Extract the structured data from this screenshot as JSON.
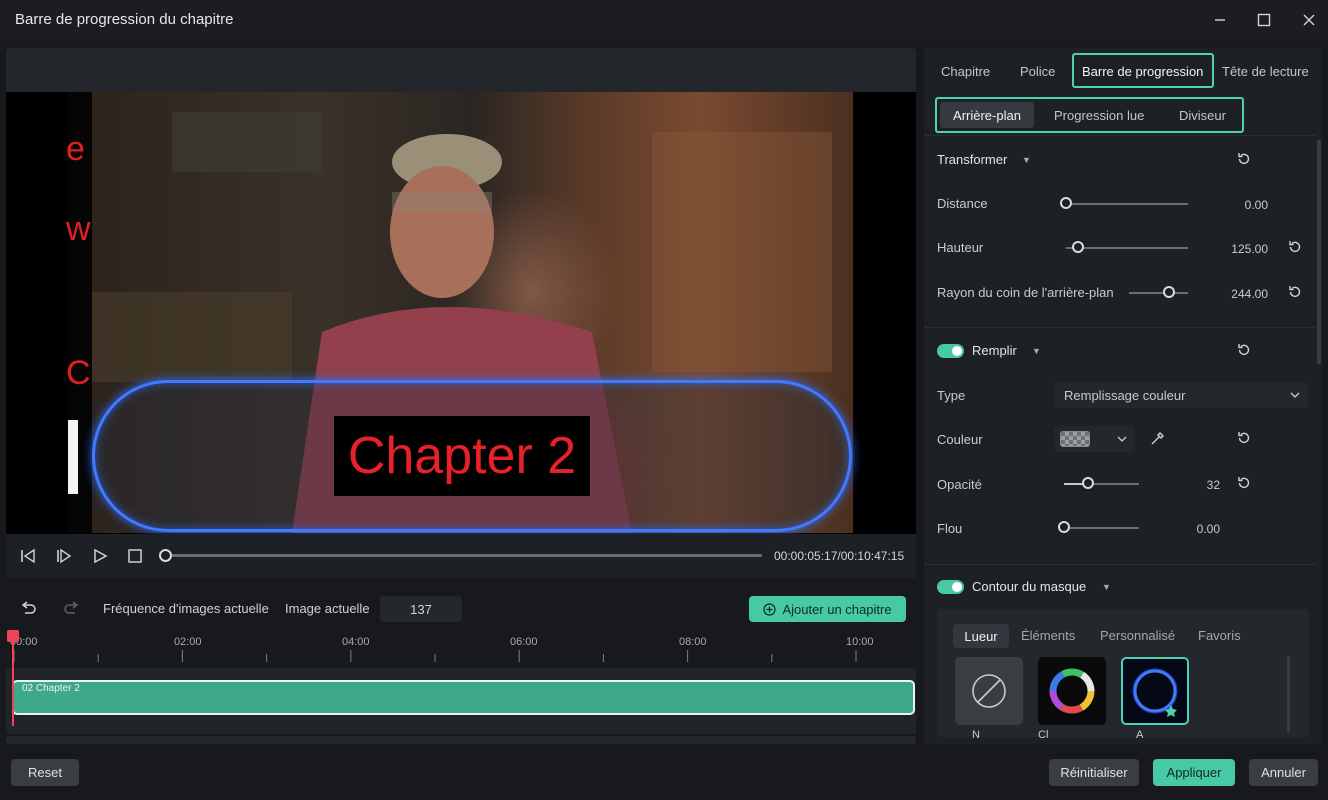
{
  "window": {
    "title": "Barre de progression du chapitre"
  },
  "preview": {
    "side_letters": [
      "e",
      "w",
      "C"
    ],
    "chapter_text": "Chapter 2",
    "timecode": "00:00:05:17/00:10:47:15"
  },
  "timeline": {
    "fps_label": "Fréquence d'images actuelle",
    "image_label": "Image actuelle",
    "image_value": "137",
    "add_chapter_label": "Ajouter un chapitre",
    "ticks": [
      "00:00",
      "02:00",
      "04:00",
      "06:00",
      "08:00",
      "10:00"
    ],
    "clip_label": "02 Chapter 2",
    "scrub_progress": 0
  },
  "panel": {
    "tabs": [
      "Chapitre",
      "Police",
      "Barre de progression",
      "Tête de lecture"
    ],
    "subtabs": [
      "Arrière-plan",
      "Progression lue",
      "Diviseur"
    ],
    "transformer": {
      "title": "Transformer",
      "distance": {
        "label": "Distance",
        "value": "0.00",
        "fraction": 0.0
      },
      "hauteur": {
        "label": "Hauteur",
        "value": "125.00",
        "fraction": 0.1
      },
      "rayon": {
        "label": "Rayon du coin de l'arrière-plan",
        "value": "244.00",
        "fraction": 0.67
      }
    },
    "remplir": {
      "title": "Remplir",
      "type_label": "Type",
      "type_value": "Remplissage couleur",
      "couleur_label": "Couleur",
      "opacite": {
        "label": "Opacité",
        "value": "32",
        "fraction": 0.32
      },
      "flou": {
        "label": "Flou",
        "value": "0.00",
        "fraction": 0.0
      }
    },
    "contour": {
      "title": "Contour du masque",
      "fx_tabs": [
        "Lueur",
        "Éléments",
        "Personnalisé",
        "Favoris"
      ],
      "thumbs": [
        "N",
        "Cl",
        "A"
      ]
    }
  },
  "footer": {
    "reset": "Reset",
    "reinitialiser": "Réinitialiser",
    "appliquer": "Appliquer",
    "annuler": "Annuler"
  },
  "colors": {
    "accent": "#47c9a5",
    "highlight": "#4fd1b0",
    "chapter_red": "#e8202a",
    "glow_blue": "#3f7bff"
  }
}
